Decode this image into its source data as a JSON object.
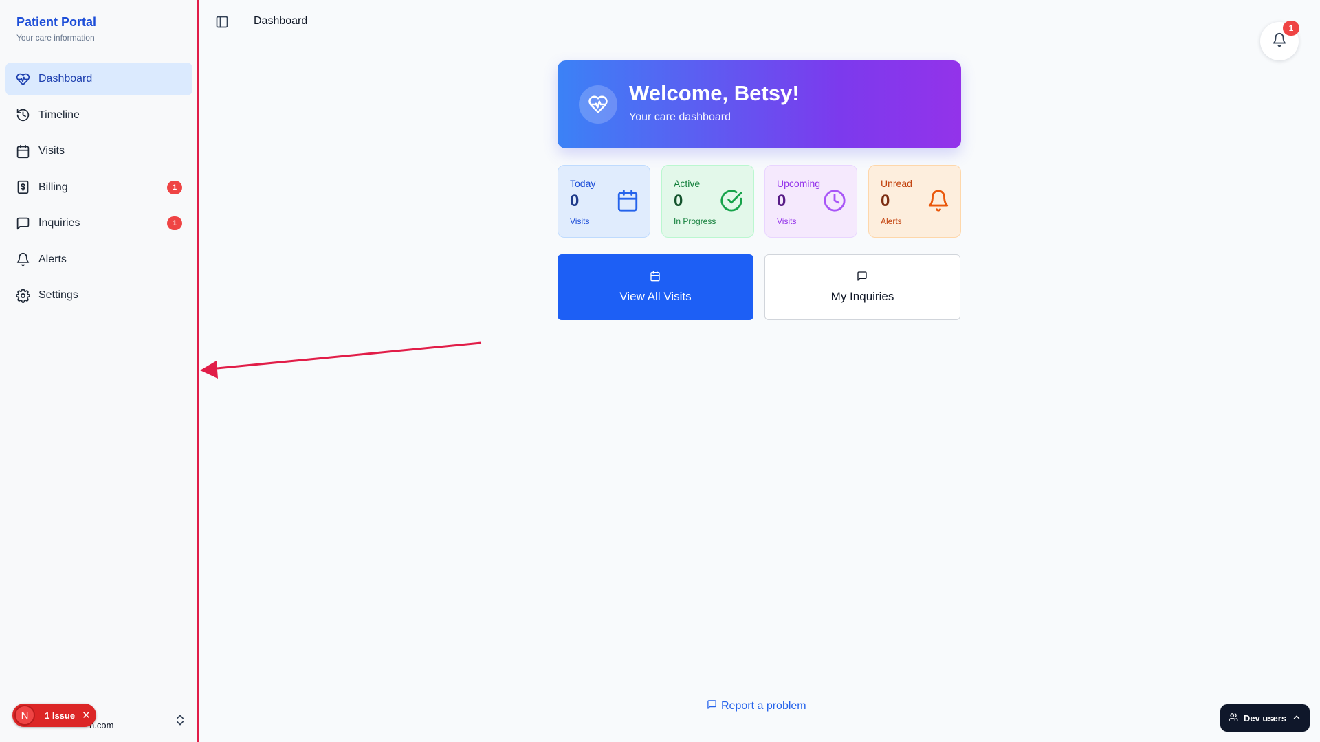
{
  "sidebar": {
    "brand_title": "Patient Portal",
    "brand_subtitle": "Your care information",
    "items": [
      {
        "label": "Dashboard",
        "icon": "heart-pulse-icon",
        "active": true
      },
      {
        "label": "Timeline",
        "icon": "history-icon"
      },
      {
        "label": "Visits",
        "icon": "calendar-icon"
      },
      {
        "label": "Billing",
        "icon": "dollar-receipt-icon",
        "badge": "1"
      },
      {
        "label": "Inquiries",
        "icon": "message-square-icon",
        "badge": "1"
      },
      {
        "label": "Alerts",
        "icon": "bell-icon"
      },
      {
        "label": "Settings",
        "icon": "gear-icon"
      }
    ],
    "footer_email_fragment": "n.com"
  },
  "header": {
    "title": "Dashboard",
    "notification_count": "1"
  },
  "welcome": {
    "title": "Welcome, Betsy!",
    "subtitle": "Your care dashboard"
  },
  "stats": [
    {
      "label": "Today",
      "value": "0",
      "sub": "Visits",
      "icon": "calendar-icon",
      "color": "#2563eb"
    },
    {
      "label": "Active",
      "value": "0",
      "sub": "In Progress",
      "icon": "check-circle-icon",
      "color": "#16a34a"
    },
    {
      "label": "Upcoming",
      "value": "0",
      "sub": "Visits",
      "icon": "clock-icon",
      "color": "#a855f7"
    },
    {
      "label": "Unread",
      "value": "0",
      "sub": "Alerts",
      "icon": "bell-icon",
      "color": "#ea580c"
    }
  ],
  "actions": {
    "view_visits": "View All Visits",
    "my_inquiries": "My Inquiries"
  },
  "footer": {
    "report_link": "Report a problem"
  },
  "dev_tools": {
    "issue_avatar": "N",
    "issue_label": "1 Issue",
    "dev_users_label": "Dev users"
  },
  "colors": {
    "accent": "#1d5ff5",
    "annotation": "#e11d48",
    "badge": "#ef4444"
  }
}
